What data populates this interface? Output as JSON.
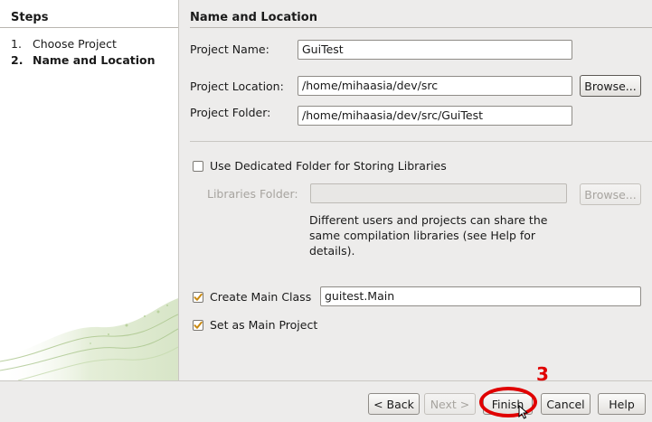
{
  "steps": {
    "title": "Steps",
    "items": [
      {
        "number": "1.",
        "label": "Choose Project"
      },
      {
        "number": "2.",
        "label": "Name and Location"
      }
    ]
  },
  "section": {
    "title": "Name and Location"
  },
  "form": {
    "project_name_label": "Project Name:",
    "project_name_value": "GuiTest",
    "project_location_label": "Project Location:",
    "project_location_value": "/home/mihaasia/dev/src",
    "browse_label": "Browse...",
    "project_folder_label": "Project Folder:",
    "project_folder_value": "/home/mihaasia/dev/src/GuiTest",
    "dedicated_folder_label": "Use Dedicated Folder for Storing Libraries",
    "dedicated_folder_checked": false,
    "libraries_folder_label": "Libraries Folder:",
    "libraries_folder_value": "",
    "libraries_browse_label": "Browse...",
    "libraries_description": "Different users and projects can share the same compilation libraries (see Help for details).",
    "create_main_class_label": "Create Main Class",
    "create_main_class_checked": true,
    "main_class_value": "guitest.Main",
    "set_main_project_label": "Set as Main Project",
    "set_main_project_checked": true
  },
  "buttons": {
    "back": "< Back",
    "next": "Next >",
    "finish": "Finish",
    "cancel": "Cancel",
    "help": "Help"
  },
  "annotation": {
    "marker": "3",
    "color": "#e00000"
  }
}
